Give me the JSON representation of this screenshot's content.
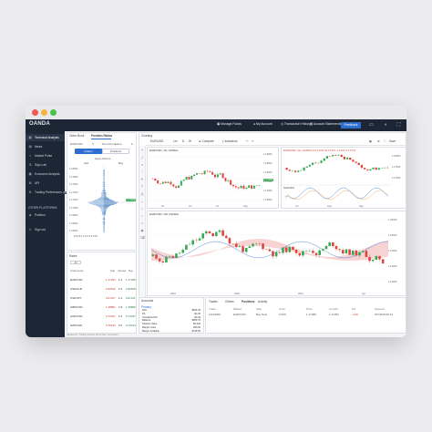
{
  "colors": {
    "nav_bg": "#1d2634",
    "accent": "#2d6fd0",
    "bull": "#34a853",
    "bear": "#e0433a",
    "dot_red": "#ee5a4f",
    "dot_yellow": "#f4b73e",
    "dot_green": "#47c24b"
  },
  "topnav": {
    "logo": "OANDA",
    "items": [
      {
        "label": "Manage Funds",
        "icon": "wallet-icon"
      },
      {
        "label": "My Account",
        "icon": "user-icon"
      },
      {
        "label": "Transaction History",
        "icon": "history-icon"
      },
      {
        "label": "Account Statements",
        "icon": "statement-icon"
      }
    ],
    "feedback": "Feedback"
  },
  "sidebar": {
    "items": [
      {
        "label": "Technical Analysis",
        "icon": "chart-icon"
      },
      {
        "label": "News",
        "icon": "news-icon"
      },
      {
        "label": "Market Pulse",
        "icon": "pulse-icon"
      },
      {
        "label": "Sign Lab",
        "icon": "lab-icon"
      },
      {
        "label": "Economic Analysis",
        "icon": "calendar-icon"
      },
      {
        "label": "API",
        "icon": "api-icon"
      },
      {
        "label": "Trading Preferences",
        "icon": "gear-icon",
        "badge": "NEW"
      }
    ],
    "other_header": "OTHER PLATFORMS",
    "other_items": [
      {
        "label": "Position",
        "icon": "position-icon"
      }
    ],
    "logout": "Sign out"
  },
  "order_panel": {
    "tabs": [
      "Order Book",
      "Position Ratios"
    ],
    "instrument": "EUR/USD",
    "mode": "Non-Cumulative",
    "subtabs": [
      "Orders",
      "Positions"
    ],
    "caption": "Open Orders",
    "sell": "Sell",
    "buy": "Buy",
    "price_labels": [
      "1.18000",
      "1.17800",
      "1.17600",
      "1.17400",
      "1.17200",
      "1.17000",
      "1.16800",
      "1.16600",
      "1.16400"
    ],
    "highlight_price": "1.17262",
    "axis_labels": "10  8  6  4  2  0  2  4  6  8  10"
  },
  "rates_panel": {
    "tabs": [
      "Rates",
      "All"
    ],
    "columns": [
      "Instruments",
      "Sell",
      "Spread",
      "Buy"
    ],
    "rows": [
      {
        "pair": "EUR/USD",
        "sell": "1.17254",
        "spread": "1.4",
        "buy": "1.17268"
      },
      {
        "pair": "USD/CHF",
        "sell": "0.92512",
        "spread": "1.6",
        "buy": "0.92528"
      },
      {
        "pair": "USD/JPY",
        "sell": "110.427",
        "spread": "1.4",
        "buy": "110.441"
      },
      {
        "pair": "GBP/USD",
        "sell": "1.38851",
        "spread": "1.8",
        "buy": "1.38869"
      },
      {
        "pair": "AUD/USD",
        "sell": "0.73221",
        "spread": "1.6",
        "buy": "0.73237"
      },
      {
        "pair": "NZD/USD",
        "sell": "0.70193",
        "spread": "2.0",
        "buy": "0.70213"
      }
    ]
  },
  "charting": {
    "title": "Charting",
    "toolbar": {
      "instrument": "EUR/USD",
      "timeframes": [
        "1m",
        "D",
        "W"
      ],
      "compare": "Compare",
      "indicators": "Indicators",
      "save": "Save"
    },
    "chart1": {
      "legend": "EUR/USD, 1D, OANDA",
      "prices": [
        "1.19000",
        "1.18500",
        "1.18000",
        "1.17500",
        "1.17000",
        "1.16500"
      ],
      "highlight": "1.17262",
      "xticks": [
        "15",
        "Jul",
        "12",
        "Aug"
      ]
    },
    "chart2": {
      "legend": "EUR/USD, 4H, OANDA  O1.1726 H1.1734 L1.1721 C1.1727",
      "prices": [
        "1.18000",
        "1.17500",
        "1.17000"
      ],
      "osc_label": "Stoch RSI",
      "xticks": [
        "Jul",
        "Aug",
        "Sep"
      ]
    },
    "chart3": {
      "legend": "EUR/USD, 1W, OANDA",
      "prices": [
        "1.20000",
        "1.18000",
        "1.16000",
        "1.14000",
        "1.12000"
      ],
      "xticks": [
        "2019",
        "2020",
        "2021",
        "Apr"
      ]
    }
  },
  "account_panel": {
    "header": "Accounts",
    "primary": "Primary",
    "rows": [
      {
        "label": "NAV",
        "value": "$846.39"
      },
      {
        "label": "P/L",
        "value": "-$4.40"
      },
      {
        "label": "Unrealized P/L",
        "value": "-$4.40"
      },
      {
        "label": "Balance",
        "value": "$850.79"
      },
      {
        "label": "Position Value",
        "value": "$2,342"
      },
      {
        "label": "Margin Used",
        "value": "$46.84"
      },
      {
        "label": "Margin Available",
        "value": "$799.55"
      }
    ]
  },
  "trades_panel": {
    "tabs": [
      "Trades",
      "Orders",
      "Positions",
      "Activity"
    ],
    "columns": [
      "Trade",
      "Market",
      "Side",
      "Units",
      "Price",
      "Current",
      "P/L",
      "Opened"
    ],
    "rows": [
      {
        "trade": "11214932",
        "market": "EUR/USD",
        "side": "Buy Now",
        "units": "2,000",
        "price": "1.17480",
        "current": "1.17254",
        "pl": "-4.40",
        "opened": "07/19/19 09:14"
      }
    ]
  },
  "footer": "oanda.com  |  Trading involves risk of loss  |  Connected"
}
